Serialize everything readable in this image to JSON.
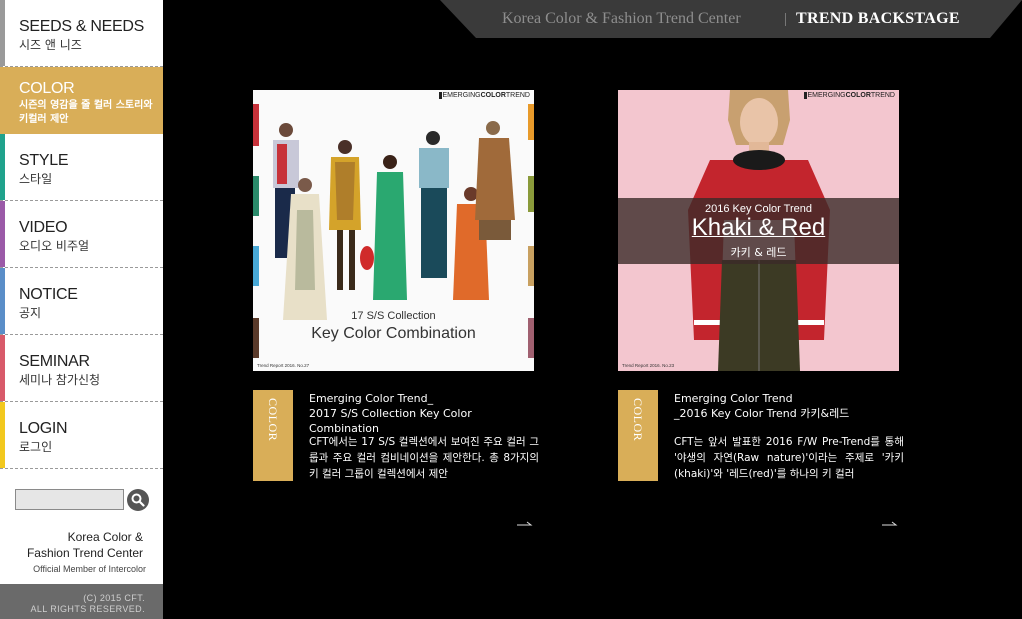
{
  "sidebar": {
    "items": [
      {
        "en": "SEEDS & NEEDS",
        "ko": "시즈 앤 니즈",
        "color": "#9a9a9a"
      },
      {
        "en": "COLOR",
        "ko": "시즌의 영감을 줄 컬러 스토리와 키컬러 제안",
        "color": "#d9ae58"
      },
      {
        "en": "STYLE",
        "ko": "스타일",
        "color": "#20a28c"
      },
      {
        "en": "VIDEO",
        "ko": "오디오 비주얼",
        "color": "#9b5aa8"
      },
      {
        "en": "NOTICE",
        "ko": "공지",
        "color": "#5a8ec8"
      },
      {
        "en": "SEMINAR",
        "ko": "세미나 참가신청",
        "color": "#d85a6a"
      },
      {
        "en": "LOGIN",
        "ko": "로그인",
        "color": "#f2c81e"
      }
    ],
    "search": {
      "placeholder": ""
    },
    "brand": {
      "line1": "Korea Color &",
      "line2": "Fashion Trend Center",
      "line3": "Official Member of Intercolor"
    },
    "copyright": {
      "line1": "(C) 2015 CFT.",
      "line2": "ALL RIGHTS RESERVED."
    }
  },
  "header": {
    "org": "Korea Color & Fashion Trend Center",
    "section": "TREND BACKSTAGE"
  },
  "cards": [
    {
      "tag": "COLOR",
      "report_tag_prefix": "EMERGING",
      "report_tag_bold": "COLOR",
      "report_tag_suffix": "TREND",
      "image_line1": "17 S/S Collection",
      "image_line2": "Key Color Combination",
      "report_no": "Trend Report 2016. No.27",
      "title_line1": "Emerging Color Trend_",
      "title_line2": "2017 S/S Collection Key Color Combination",
      "desc": "CFT에서는 17 S/S 컬렉션에서 보여진 주요 컬러 그룹과 주요 컬러 컴비네이션을 제안한다. 총 8가지의 키 컬러 그룹이 컬렉션에서 제안"
    },
    {
      "tag": "COLOR",
      "report_tag_prefix": "EMERGING",
      "report_tag_bold": "COLOR",
      "report_tag_suffix": "TREND",
      "image_line1": "2016  Key Color Trend",
      "image_line2": "Khaki & Red",
      "image_line3": "카키 & 레드",
      "report_no": "Trend Report 2016. No.23",
      "title_line1": "Emerging Color Trend",
      "title_line2": "_2016 Key Color Trend 카키&레드",
      "desc": "CFT는 앞서 발표한 2016 F/W Pre-Trend를 통해 '야생의 자연(Raw nature)'이라는 주제로 '카키(khaki)'와 '레드(red)'를 하나의 키 컬러"
    }
  ],
  "colors": {
    "accent": "#d9ae58",
    "header_band": "#3a3a3a",
    "background": "#000000"
  }
}
